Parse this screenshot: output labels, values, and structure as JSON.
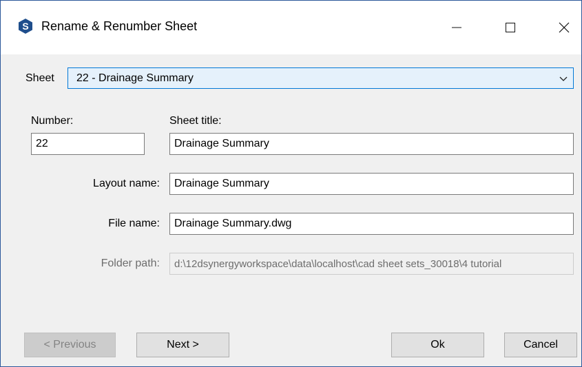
{
  "window": {
    "title": "Rename & Renumber Sheet",
    "accent_color": "#0078d7",
    "icon": "app-s-logo-icon"
  },
  "sheet": {
    "label": "Sheet",
    "selected": "22 - Drainage Summary"
  },
  "number": {
    "label": "Number:",
    "value": "22"
  },
  "sheet_title": {
    "label": "Sheet title:",
    "value": "Drainage Summary"
  },
  "layout_name": {
    "label": "Layout name:",
    "value": "Drainage Summary"
  },
  "file_name": {
    "label": "File name:",
    "value": "Drainage Summary.dwg"
  },
  "folder_path": {
    "label": "Folder path:",
    "value": "d:\\12dsynergyworkspace\\data\\localhost\\cad sheet sets_30018\\4 tutorial"
  },
  "buttons": {
    "previous": "< Previous",
    "next": "Next >",
    "ok": "Ok",
    "cancel": "Cancel"
  }
}
